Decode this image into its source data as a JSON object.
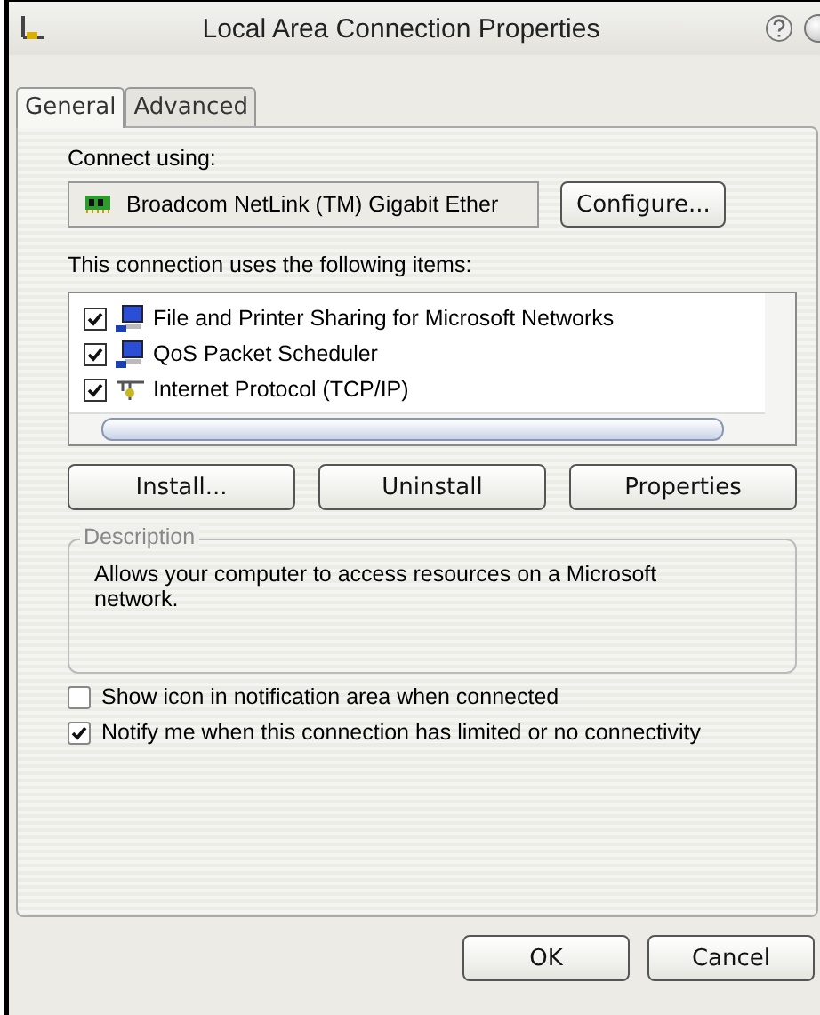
{
  "window": {
    "title": "Local Area Connection Properties"
  },
  "tabs": [
    {
      "label": "General",
      "selected": true
    },
    {
      "label": "Advanced",
      "selected": false
    }
  ],
  "connect_using": {
    "label": "Connect using:",
    "adapter": "Broadcom NetLink (TM) Gigabit Ether",
    "button": "Configure..."
  },
  "items_label": "This connection uses the following items:",
  "items": [
    {
      "label": "File and Printer Sharing for Microsoft Networks",
      "checked": true,
      "kind": "computer"
    },
    {
      "label": "QoS Packet Scheduler",
      "checked": true,
      "kind": "computer"
    },
    {
      "label": "Internet Protocol (TCP/IP)",
      "checked": true,
      "kind": "protocol"
    }
  ],
  "item_buttons": [
    "Install...",
    "Uninstall",
    "Properties"
  ],
  "description": {
    "title": "Description",
    "text": "Allows your computer to access resources on a Microsoft network."
  },
  "options": [
    {
      "label": "Show icon in notification area when connected",
      "checked": false
    },
    {
      "label": "Notify me when this connection has limited or no connectivity",
      "checked": true
    }
  ],
  "buttons": [
    "OK",
    "Cancel"
  ]
}
